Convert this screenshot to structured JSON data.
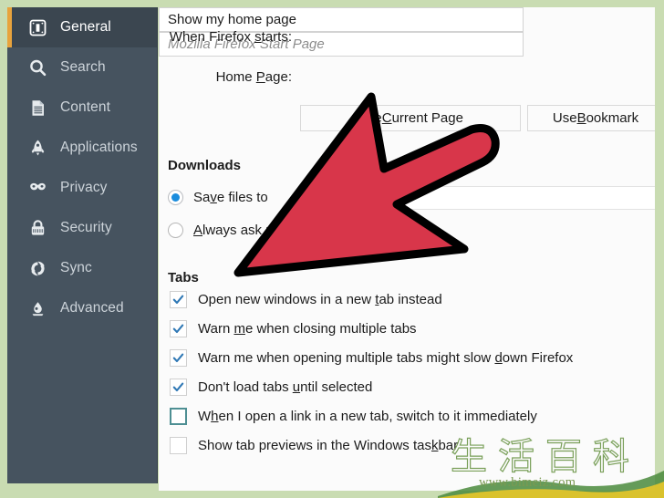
{
  "window": {
    "border_color": "#c9dcb2",
    "panel_background": "#fbfbfb"
  },
  "sidebar": {
    "background": "#46535f",
    "selected_background": "#3b4650",
    "accent_color": "#e8a33d",
    "items": [
      {
        "label": "General",
        "icon": "general-icon",
        "selected": true
      },
      {
        "label": "Search",
        "icon": "search-icon",
        "selected": false
      },
      {
        "label": "Content",
        "icon": "content-icon",
        "selected": false
      },
      {
        "label": "Applications",
        "icon": "applications-icon",
        "selected": false
      },
      {
        "label": "Privacy",
        "icon": "privacy-mask-icon",
        "selected": false
      },
      {
        "label": "Security",
        "icon": "lock-icon",
        "selected": false
      },
      {
        "label": "Sync",
        "icon": "sync-icon",
        "selected": false
      },
      {
        "label": "Advanced",
        "icon": "advanced-icon",
        "selected": false
      }
    ]
  },
  "startup": {
    "when_firefox_starts_label": "When Firefox starts:",
    "when_firefox_starts_accesskey": "s",
    "when_firefox_starts_value": "Show my home page",
    "home_page_label": "Home Page:",
    "home_page_accesskey": "P",
    "home_page_placeholder": "Mozilla Firefox Start Page",
    "home_page_value": "",
    "use_current_page_label": "Use Current Page",
    "use_current_page_accesskey": "C",
    "use_bookmark_label": "Use Bookmark",
    "use_bookmark_accesskey": "B"
  },
  "downloads": {
    "heading": "Downloads",
    "options": [
      {
        "label": "Save files to",
        "accesskey": "v",
        "checked": true
      },
      {
        "label": "Always ask me where to save files",
        "accesskey": "A",
        "checked": false
      }
    ]
  },
  "tabs": {
    "heading": "Tabs",
    "options": [
      {
        "label": "Open new windows in a new tab instead",
        "accesskey": "t",
        "checked": true,
        "focused": false
      },
      {
        "label": "Warn me when closing multiple tabs",
        "accesskey": "m",
        "checked": true,
        "focused": false
      },
      {
        "label": "Warn me when opening multiple tabs might slow down Firefox",
        "accesskey": "d",
        "checked": true,
        "focused": false
      },
      {
        "label": "Don't load tabs until selected",
        "accesskey": "u",
        "checked": true,
        "focused": false
      },
      {
        "label": "When I open a link in a new tab, switch to it immediately",
        "accesskey": "h",
        "checked": false,
        "focused": true
      },
      {
        "label": "Show tab previews in the Windows taskbar",
        "accesskey": "k",
        "checked": false,
        "focused": false
      }
    ]
  },
  "annotation": {
    "arrow_fill": "#d8364a",
    "arrow_stroke": "#000000",
    "points_to": "Tabs"
  },
  "watermark": {
    "characters": "生活百科",
    "url": "www.bimeiz.com",
    "character_color": "#7aa05a",
    "url_color": "#7b9a52",
    "swoosh_green": "#4a8a3c",
    "swoosh_yellow": "#e8c62a"
  }
}
